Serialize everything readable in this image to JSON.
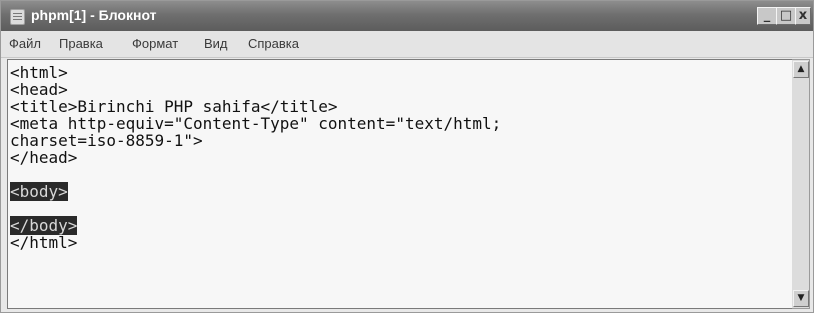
{
  "window": {
    "title": "phpm[1] - Блокнот",
    "controls": {
      "minimize": "_",
      "maximize": "□",
      "close": "x"
    }
  },
  "menu": [
    "Файл",
    "Правка",
    "Формат",
    "Вид",
    "Справка"
  ],
  "editor": {
    "lines": [
      "<html>",
      "<head>",
      "<title>Birinchi PHP sahifa</title>",
      "<meta http-equiv=\"Content-Type\" content=\"text/html;",
      "charset=iso-8859-1\">",
      "</head>",
      "",
      "<body>",
      "",
      "</body>",
      "</html>"
    ]
  },
  "scrollbar": {
    "up_icon": "arrow-up-icon",
    "down_icon": "arrow-down-icon"
  }
}
